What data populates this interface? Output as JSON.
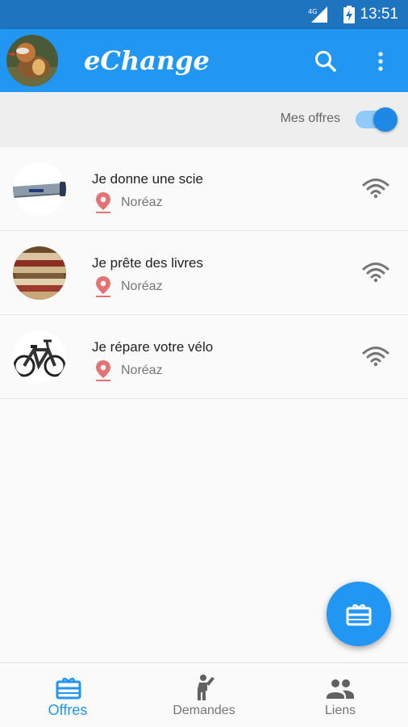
{
  "status_bar": {
    "time": "13:51",
    "network": "4G"
  },
  "app_bar": {
    "title": "eChange"
  },
  "filter": {
    "label": "Mes offres",
    "enabled": true
  },
  "offers": [
    {
      "title": "Je donne une scie",
      "location": "Noréaz",
      "image": "saw"
    },
    {
      "title": "Je prête des livres",
      "location": "Noréaz",
      "image": "books"
    },
    {
      "title": "Je répare votre vélo",
      "location": "Noréaz",
      "image": "bicycle"
    }
  ],
  "bottom_nav": [
    {
      "label": "Offres",
      "icon": "gift-icon",
      "active": true
    },
    {
      "label": "Demandes",
      "icon": "person-raising-hand-icon",
      "active": false
    },
    {
      "label": "Liens",
      "icon": "people-icon",
      "active": false
    }
  ],
  "colors": {
    "primary": "#2196f3",
    "status_bar": "#1e74bf",
    "pin": "#e57373"
  }
}
